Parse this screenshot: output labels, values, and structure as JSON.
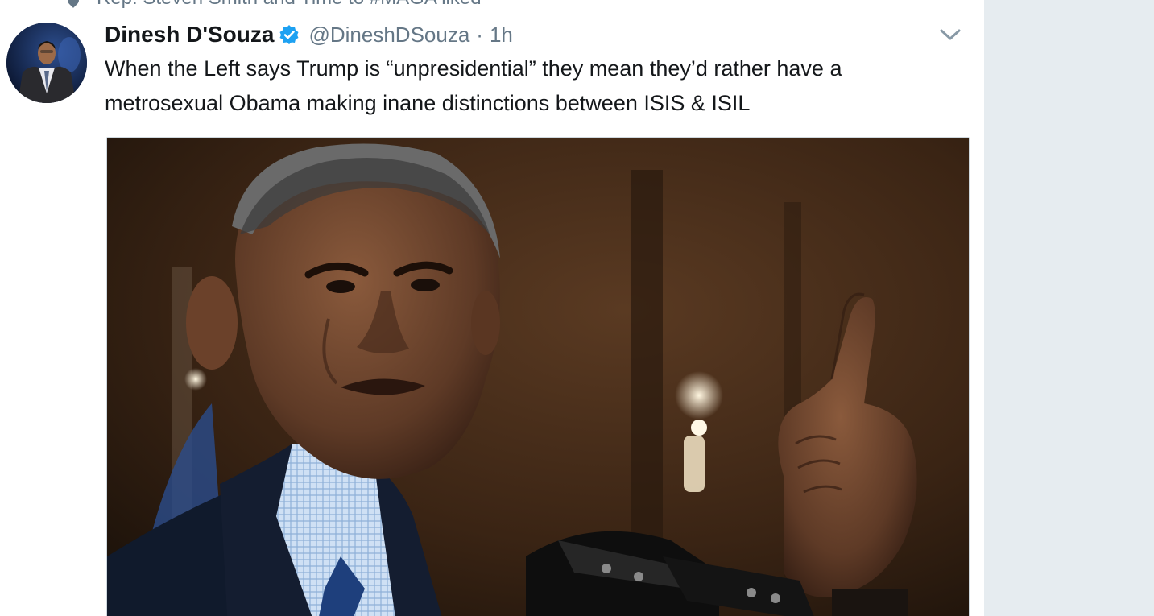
{
  "context_line": {
    "text": "Rep. Steven Smith and Time to #MAGA liked"
  },
  "tweet": {
    "author_name": "Dinesh D'Souza",
    "handle": "@DineshDSouza",
    "separator": "·",
    "time": "1h",
    "text_line_1": "When the Left says Trump is “unpresidential” they mean they’d rather have a",
    "text_line_2": "metrosexual Obama making inane distinctions between ISIS & ISIL"
  },
  "icons": {
    "verified": "verified-badge-icon",
    "caret": "chevron-down-icon",
    "context": "heart-like-icon"
  },
  "colors": {
    "verified_blue": "#1da1f2",
    "secondary_text": "#657786",
    "primary_text": "#14171a",
    "sidebar": "#e6ecf0"
  }
}
